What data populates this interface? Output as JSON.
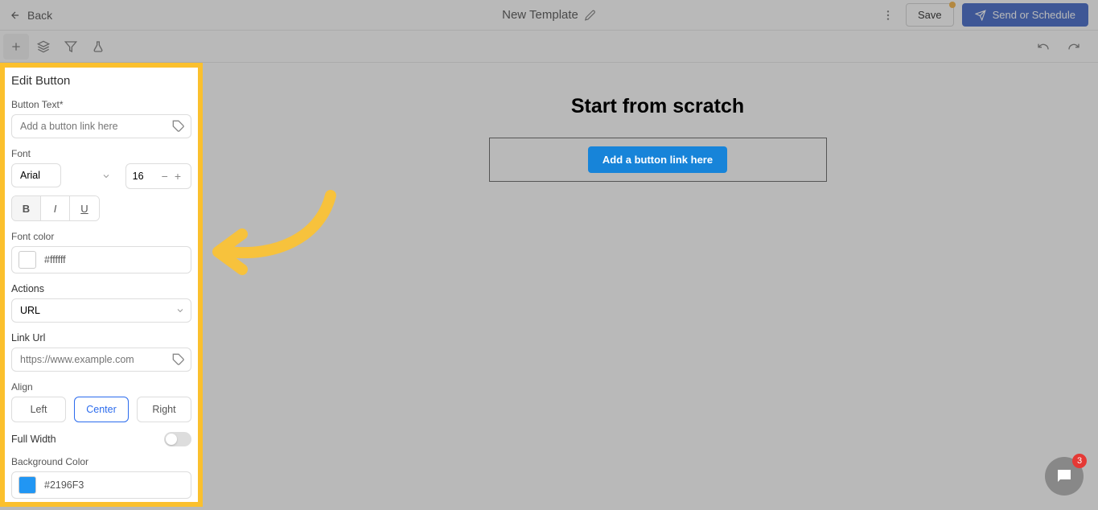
{
  "header": {
    "back": "Back",
    "title": "New Template",
    "save": "Save",
    "send": "Send or Schedule"
  },
  "canvas": {
    "heading": "Start from scratch",
    "button_text": "Add a button link here"
  },
  "panel": {
    "title": "Edit Button",
    "button_text_label": "Button Text*",
    "button_text_placeholder": "Add a button link here",
    "font_label": "Font",
    "font_value": "Arial",
    "font_size": "16",
    "font_color_label": "Font color",
    "font_color_value": "#ffffff",
    "actions_label": "Actions",
    "actions_value": "URL",
    "link_url_label": "Link Url",
    "link_url_placeholder": "https://www.example.com",
    "align_label": "Align",
    "align_left": "Left",
    "align_center": "Center",
    "align_right": "Right",
    "full_width_label": "Full Width",
    "bg_color_label": "Background Color",
    "bg_color_value": "#2196F3"
  },
  "chat": {
    "count": "3"
  }
}
